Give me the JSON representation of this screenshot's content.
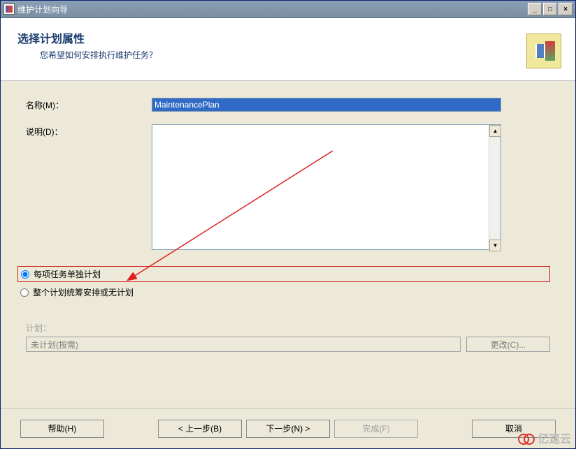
{
  "window": {
    "title": "维护计划向导"
  },
  "header": {
    "title": "选择计划属性",
    "subtitle": "您希望如何安排执行维护任务？"
  },
  "form": {
    "name_label": "名称(M)：",
    "name_value": "MaintenancePlan",
    "description_label": "说明(D)：",
    "description_value": ""
  },
  "radios": {
    "option1": "每项任务单独计划",
    "option2": "整个计划统筹安排或无计划"
  },
  "schedule": {
    "label": "计划：",
    "value": "未计划(按需)",
    "change_btn": "更改(C)..."
  },
  "footer": {
    "help": "帮助(H)",
    "back": "< 上一步(B)",
    "next": "下一步(N) >",
    "finish": "完成(F)",
    "cancel": "取消"
  },
  "watermark": "亿速云"
}
